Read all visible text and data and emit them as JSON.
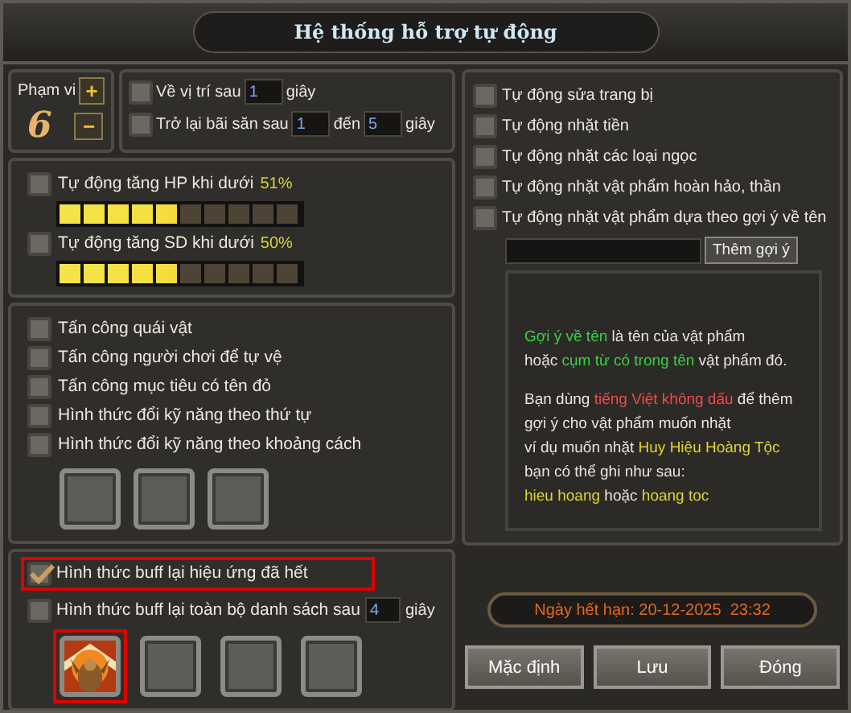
{
  "window": {
    "title": "Hệ thống hỗ trợ tự động"
  },
  "range": {
    "label": "Phạm vi",
    "plus": "+",
    "value": "6",
    "minus": "−"
  },
  "return_options": [
    {
      "label": "Về vị trí sau",
      "checked": false,
      "from": "1",
      "unit": "giây"
    },
    {
      "label": "Trở lại bãi săn sau",
      "checked": false,
      "from": "1",
      "between": "đến",
      "to": "5",
      "unit": "giây"
    }
  ],
  "potions": [
    {
      "label": "Tự động tăng HP khi dưới",
      "percent": "51%",
      "checked": false,
      "level": 0.5
    },
    {
      "label": "Tự động tăng SD khi dưới",
      "percent": "50%",
      "checked": false,
      "level": 0.5
    }
  ],
  "attack_options": [
    {
      "label": "Tấn công quái vật",
      "checked": false
    },
    {
      "label": "Tấn công người chơi để tự vệ",
      "checked": false
    },
    {
      "label": "Tấn công mục tiêu có tên đỏ",
      "checked": false
    },
    {
      "label": "Hình thức đổi kỹ năng theo thứ tự",
      "checked": false
    },
    {
      "label": "Hình thức đổi kỹ năng theo khoảng cách",
      "checked": false
    }
  ],
  "skill_slots": [
    {
      "kind": "empty"
    },
    {
      "kind": "empty"
    },
    {
      "kind": "empty"
    }
  ],
  "buff_options": [
    {
      "label": "Hình thức buff lại hiệu ứng đã hết",
      "checked": true,
      "highlighted": true
    },
    {
      "label": "Hình thức buff lại toàn bộ danh sách sau",
      "checked": false,
      "highlighted": false,
      "value": "4",
      "unit": "giây"
    }
  ],
  "buff_slots": [
    {
      "kind": "picture",
      "highlighted": true
    },
    {
      "kind": "empty",
      "highlighted": false
    },
    {
      "kind": "empty",
      "highlighted": false
    },
    {
      "kind": "empty",
      "highlighted": false
    }
  ],
  "pickup_options": [
    {
      "label": "Tự động sửa trang bị",
      "checked": false
    },
    {
      "label": "Tự động nhặt tiền",
      "checked": false
    },
    {
      "label": "Tự động nhặt các loại ngọc",
      "checked": false
    },
    {
      "label": "Tự động nhặt vật phẩm hoàn hảo, thần",
      "checked": false
    },
    {
      "label": "Tự động nhặt vật phẩm dựa theo gợi ý về tên",
      "checked": false
    }
  ],
  "add_hint_button": "Thêm gợi ý",
  "hint_paragraphs": [
    [
      [
        {
          "kind": "keyword",
          "text": "Gợi ý về tên"
        },
        {
          "kind": "plain",
          "text": " là tên của vật phẩm"
        }
      ],
      [
        {
          "kind": "plain",
          "text": "hoặc "
        },
        {
          "kind": "keyword",
          "text": "cụm từ có trong tên"
        },
        {
          "kind": "plain",
          "text": " vật phẩm đó."
        }
      ]
    ],
    [
      [
        {
          "kind": "plain",
          "text": "Bạn dùng "
        },
        {
          "kind": "warning",
          "text": "tiếng Việt không dấu"
        },
        {
          "kind": "plain",
          "text": " để thêm"
        }
      ],
      [
        {
          "kind": "plain",
          "text": "gợi ý cho vật phẩm muốn nhặt"
        }
      ],
      [
        {
          "kind": "plain",
          "text": "ví dụ muốn nhặt "
        },
        {
          "kind": "example",
          "text": "Huy Hiệu Hoàng Tộc"
        }
      ],
      [
        {
          "kind": "plain",
          "text": "bạn có thể ghi như sau:"
        }
      ],
      [
        {
          "kind": "example",
          "text": "hieu hoang"
        },
        {
          "kind": "plain",
          "text": " hoặc "
        },
        {
          "kind": "example",
          "text": "hoang toc"
        }
      ]
    ]
  ],
  "expiry": "Ngày hết hạn: 20-12-2025  23:32",
  "buttons": [
    "Mặc định",
    "Lưu",
    "Đóng"
  ]
}
